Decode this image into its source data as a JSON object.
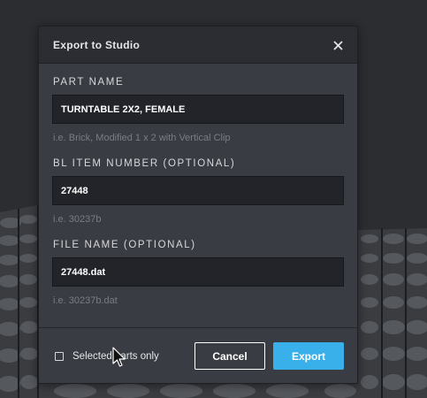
{
  "dialog": {
    "title": "Export to Studio",
    "close_icon": "close-icon"
  },
  "fields": {
    "part_name": {
      "label": "PART NAME",
      "value": "TURNTABLE 2X2, FEMALE",
      "hint": "i.e. Brick, Modified 1 x 2 with Vertical Clip"
    },
    "bl_item_number": {
      "label": "BL ITEM NUMBER (OPTIONAL)",
      "value": "27448",
      "hint": "i.e. 30237b"
    },
    "file_name": {
      "label": "FILE NAME (OPTIONAL)",
      "value": "27448.dat",
      "hint": "i.e. 30237b.dat"
    }
  },
  "footer": {
    "selected_only_label": "Selected parts only",
    "selected_only_checked": false,
    "cancel_label": "Cancel",
    "export_label": "Export"
  },
  "colors": {
    "accent": "#3ab0ea",
    "dialog_bg": "#393c42",
    "header_bg": "#2b2d32",
    "input_bg": "#22242a"
  }
}
